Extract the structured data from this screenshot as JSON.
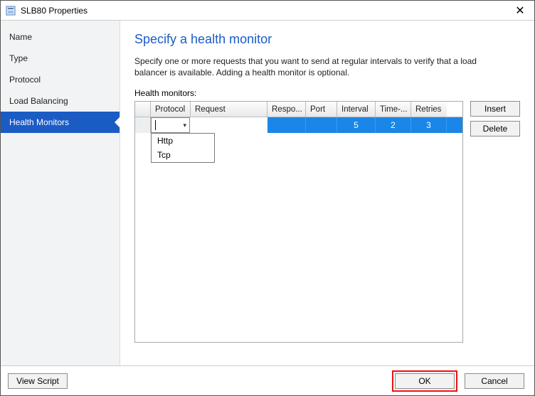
{
  "window": {
    "title": "SLB80 Properties"
  },
  "sidebar": {
    "items": [
      {
        "label": "Name"
      },
      {
        "label": "Type"
      },
      {
        "label": "Protocol"
      },
      {
        "label": "Load Balancing"
      },
      {
        "label": "Health Monitors"
      }
    ],
    "activeIndex": 4
  },
  "main": {
    "heading": "Specify a health monitor",
    "description": "Specify one or more requests that you want to send at regular intervals to verify that a load balancer is available. Adding a health monitor is optional.",
    "gridLabel": "Health monitors:",
    "columns": {
      "protocol": "Protocol",
      "request": "Request",
      "response": "Respo...",
      "port": "Port",
      "interval": "Interval",
      "timeout": "Time-...",
      "retries": "Retries"
    },
    "row": {
      "protocol": "",
      "request": "",
      "response": "",
      "port": "",
      "interval": "5",
      "timeout": "2",
      "retries": "3"
    },
    "protocolOptions": [
      "Http",
      "Tcp"
    ],
    "buttons": {
      "insert": "Insert",
      "delete": "Delete"
    }
  },
  "footer": {
    "viewScript": "View Script",
    "ok": "OK",
    "cancel": "Cancel"
  }
}
